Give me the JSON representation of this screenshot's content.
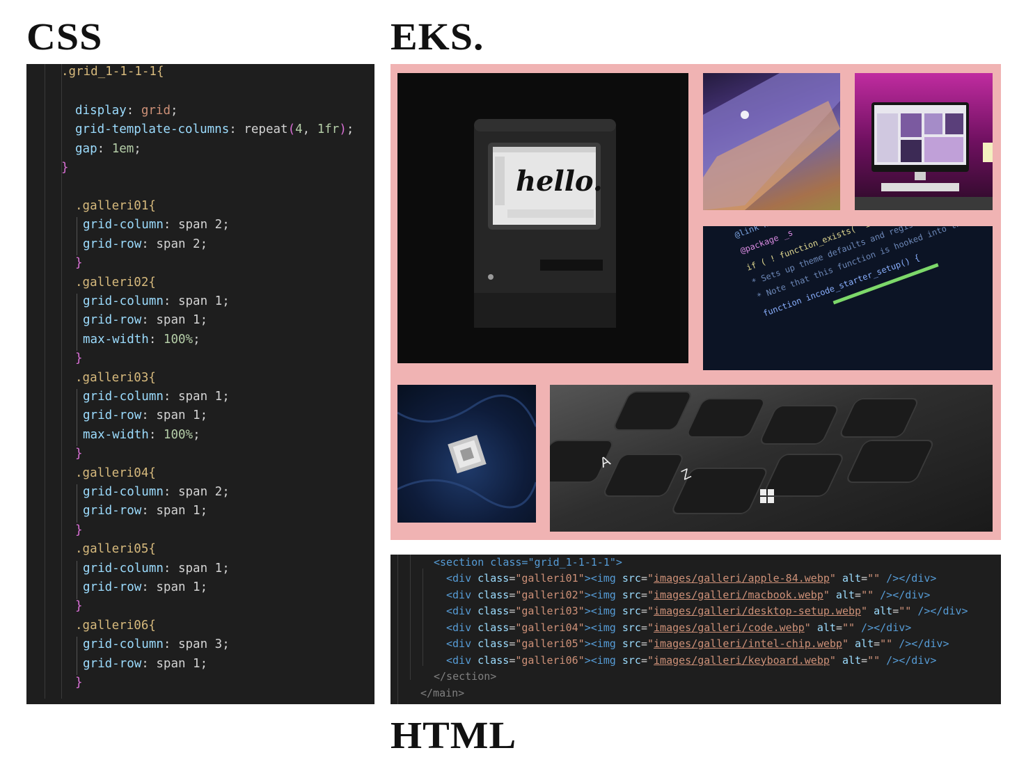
{
  "headings": {
    "css": "CSS",
    "eks": "EKS.",
    "html": "HTML"
  },
  "css_code": {
    "root_selector": ".grid_1-1-1-1{",
    "root_close": "}",
    "display": {
      "prop": "display",
      "value": "grid"
    },
    "template": {
      "prop": "grid-template-columns",
      "fn": "repeat",
      "n": "4",
      "unit": "1fr"
    },
    "gap": {
      "prop": "gap",
      "value": "1em"
    },
    "rules": [
      {
        "selector": ".galleri01{",
        "col": "span 2",
        "row": "span 2",
        "maxw": ""
      },
      {
        "selector": ".galleri02{",
        "col": "span 1",
        "row": "span 1",
        "maxw": "100%"
      },
      {
        "selector": ".galleri03{",
        "col": "span 1",
        "row": "span 1",
        "maxw": "100%"
      },
      {
        "selector": ".galleri04{",
        "col": "span 2",
        "row": "span 1",
        "maxw": ""
      },
      {
        "selector": ".galleri05{",
        "col": "span 1",
        "row": "span 1",
        "maxw": ""
      },
      {
        "selector": ".galleri06{",
        "col": "span 3",
        "row": "span 1",
        "maxw": ""
      }
    ]
  },
  "gallery": {
    "background": "#f0b3b3",
    "hello_text": "hello.",
    "code_lines": [
      "@link https://deve",
      "@package _s",
      "if ( ! function_exists( 'incode_starter_setup' ) ) :",
      "* Sets up theme defaults and registers support for various WordPress features.",
      "* Note that this function is hooked into the after_setup_theme hook",
      "function incode_starter_setup() {"
    ],
    "keys": [
      "A",
      "Z"
    ]
  },
  "html_code": {
    "section_open": "<section class=\"grid_1-1-1-1\">",
    "rows": [
      {
        "cls": "galleri01",
        "src": "images/galleri/apple-84.webp"
      },
      {
        "cls": "galleri02",
        "src": "images/galleri/macbook.webp"
      },
      {
        "cls": "galleri03",
        "src": "images/galleri/desktop-setup.webp"
      },
      {
        "cls": "galleri04",
        "src": "images/galleri/code.webp"
      },
      {
        "cls": "galleri05",
        "src": "images/galleri/intel-chip.webp"
      },
      {
        "cls": "galleri06",
        "src": "images/galleri/keyboard.webp"
      }
    ],
    "section_close": "</section>",
    "main_close": "</main>"
  },
  "colors": {
    "editor_bg": "#1e1e1e",
    "selector": "#d7ba7d",
    "bracket": "#da70d6",
    "property": "#9cdcfe",
    "string": "#ce9178",
    "tag": "#569cd6",
    "number": "#b5cea8"
  }
}
